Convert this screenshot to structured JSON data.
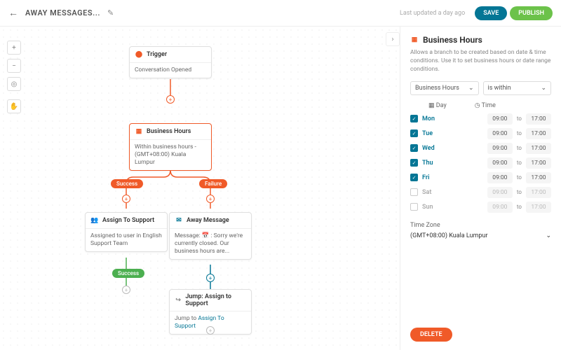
{
  "header": {
    "title": "AWAY MESSAGES...",
    "updated": "Last updated a day ago",
    "save": "SAVE",
    "publish": "PUBLISH"
  },
  "nodes": {
    "trigger": {
      "title": "Trigger",
      "body": "Conversation Opened"
    },
    "hours": {
      "title": "Business Hours",
      "body": "Within business hours - (GMT+08:00) Kuala Lumpur"
    },
    "assign": {
      "title": "Assign To Support",
      "body": "Assigned to user in English Support Team"
    },
    "away": {
      "title": "Away Message",
      "body": "Message: 📅 : Sorry we're currently closed. Our business hours are..."
    },
    "jump": {
      "title": "Jump: Assign to Support",
      "body_prefix": "Jump to ",
      "body_link": "Assign To Support"
    }
  },
  "branches": {
    "success": "Success",
    "failure": "Failure"
  },
  "panel": {
    "title": "Business Hours",
    "desc": "Allows a branch to be created based on date & time conditions. Use it to set business hours or date range conditions.",
    "cond_type": "Business Hours",
    "cond_op": "is within",
    "day_label": "Day",
    "time_label": "Time",
    "days": [
      {
        "name": "Mon",
        "on": true,
        "from": "09:00",
        "to": "17:00"
      },
      {
        "name": "Tue",
        "on": true,
        "from": "09:00",
        "to": "17:00"
      },
      {
        "name": "Wed",
        "on": true,
        "from": "09:00",
        "to": "17:00"
      },
      {
        "name": "Thu",
        "on": true,
        "from": "09:00",
        "to": "17:00"
      },
      {
        "name": "Fri",
        "on": true,
        "from": "09:00",
        "to": "17:00"
      },
      {
        "name": "Sat",
        "on": false,
        "from": "09:00",
        "to": "17:00"
      },
      {
        "name": "Sun",
        "on": false,
        "from": "09:00",
        "to": "17:00"
      }
    ],
    "to_word": "to",
    "tz_label": "Time Zone",
    "tz_value": "(GMT+08:00) Kuala Lumpur",
    "delete": "DELETE"
  }
}
